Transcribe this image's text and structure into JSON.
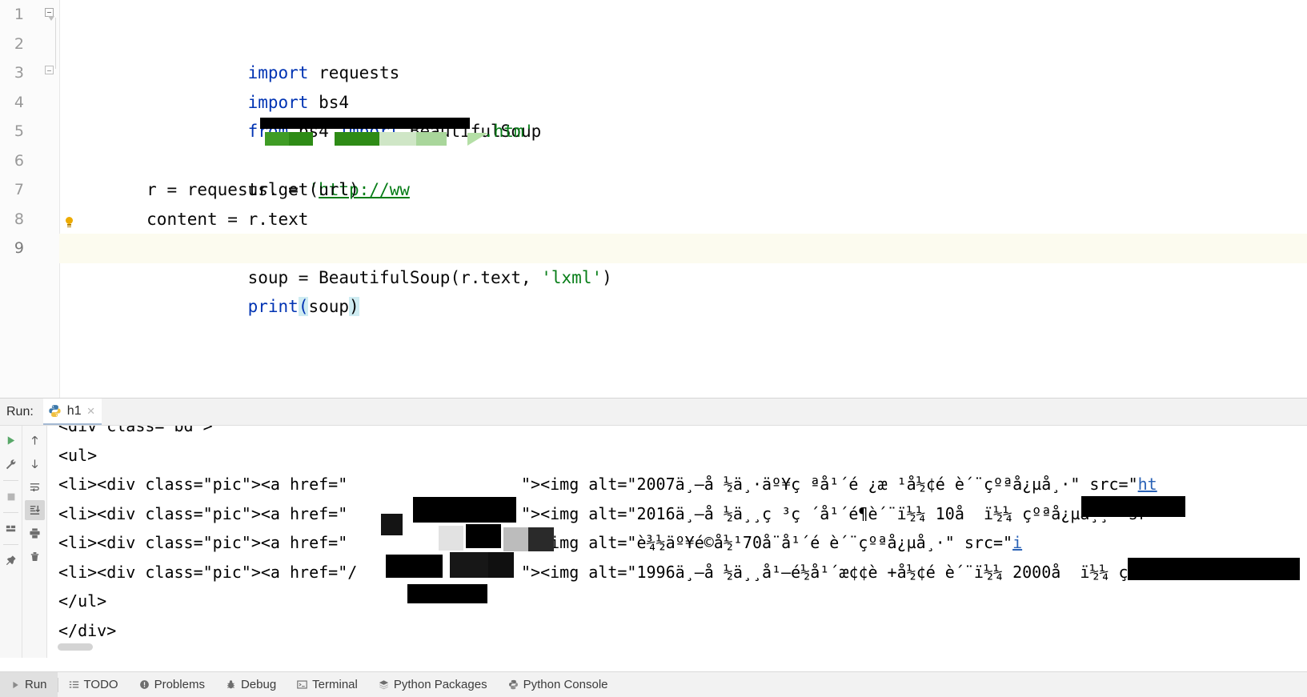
{
  "editor": {
    "lines": [
      {
        "num": "1",
        "tokens": [
          {
            "t": "import",
            "c": "kw"
          },
          {
            "t": " requests",
            "c": "plain"
          }
        ]
      },
      {
        "num": "2",
        "tokens": [
          {
            "t": "import",
            "c": "kw"
          },
          {
            "t": " bs4",
            "c": "plain"
          }
        ]
      },
      {
        "num": "3",
        "tokens": [
          {
            "t": "from",
            "c": "kw"
          },
          {
            "t": " bs4 ",
            "c": "plain"
          },
          {
            "t": "import",
            "c": "kw"
          },
          {
            "t": " BeautifulSoup",
            "c": "plain"
          }
        ]
      },
      {
        "num": "4",
        "tokens": []
      },
      {
        "num": "5",
        "tokens": [
          {
            "t": "url = ",
            "c": "plain"
          },
          {
            "t": "'",
            "c": "str"
          },
          {
            "t": "http://ww",
            "c": "link"
          }
        ]
      },
      {
        "num": "6",
        "tokens": [
          {
            "t": "r = requests.get(url)",
            "c": "plain"
          }
        ]
      },
      {
        "num": "7",
        "tokens": [
          {
            "t": "content = r.text",
            "c": "plain"
          }
        ]
      },
      {
        "num": "8",
        "tokens": [
          {
            "t": "soup = BeautifulSoup(r.text, ",
            "c": "plain"
          },
          {
            "t": "'lxml'",
            "c": "str"
          },
          {
            "t": ")",
            "c": "plain"
          }
        ]
      },
      {
        "num": "9",
        "tokens": []
      }
    ],
    "line5_suffix": ".htm'",
    "line9": {
      "kw": "print",
      "open": "(",
      "arg": "soup",
      "close": ")"
    },
    "current_line": "9"
  },
  "run_panel": {
    "label": "Run:",
    "tab_name": "h1",
    "tab_close": "×",
    "toolbar_left": [
      {
        "name": "rerun-button",
        "icon": "play-icon"
      },
      {
        "name": "settings-button",
        "icon": "wrench-icon"
      },
      {
        "name": "stop-button",
        "icon": "stop-icon"
      },
      {
        "name": "layout-button",
        "icon": "layout-icon"
      },
      {
        "name": "pin-button",
        "icon": "pin-icon"
      }
    ],
    "toolbar_right": [
      {
        "name": "up-button",
        "icon": "arrow-up-icon"
      },
      {
        "name": "down-button",
        "icon": "arrow-down-icon"
      },
      {
        "name": "soft-wrap-button",
        "icon": "soft-wrap-icon"
      },
      {
        "name": "scroll-to-end-button",
        "icon": "scroll-end-icon"
      },
      {
        "name": "print-button",
        "icon": "printer-icon"
      },
      {
        "name": "clear-all-button",
        "icon": "trash-icon"
      }
    ],
    "console_lines": [
      {
        "text": "<div class=\"bd\">",
        "clipped": true
      },
      {
        "text": "<ul>"
      },
      {
        "text": "<li><div class=\"pic\"><a href=\"",
        "redacted": true,
        "tail": "\"><img alt=\"2007ä¸–å ½ä¸·äº¥ç ªå¹´é ¿æ ¹å½¢é è´¨çºªå¿µå¸·\" src=\"",
        "link_tail": "ht"
      },
      {
        "text": "<li><div class=\"pic\"><a href=\"",
        "redacted": true,
        "tail": "\"><img alt=\"2016ä¸–å ½ä¸¸ç ³ç ´å¹´é¶è´¨ï½¼ 10å  ï½¼ çºªå¿µå¸¸\" sr"
      },
      {
        "text": "<li><div class=\"pic\"><a href=\"",
        "redacted": true,
        "tail": "\"><img alt=\"è¾½äº¥é©å½¹70å¨å¹´é è´¨çºªå¿µå¸·\" src=\"",
        "link_tail": "i"
      },
      {
        "text": "<li><div class=\"pic\"><a href=\"/",
        "redacted": true,
        "tail": "\"><img alt=\"1996ä¸–å ½ä¸¸å¹–é½å¹´æ¢¢è +å½¢é è´¨ï½¼ 2000å  ï½¼ ç"
      },
      {
        "text": "</ul>"
      },
      {
        "text": "</div>"
      }
    ]
  },
  "statusbar": {
    "items": [
      {
        "label": "Run",
        "icon": "play-icon",
        "active": true
      },
      {
        "label": "TODO",
        "icon": "todo-list-icon",
        "active": false
      },
      {
        "label": "Problems",
        "icon": "warning-circle-icon",
        "active": false
      },
      {
        "label": "Debug",
        "icon": "bug-icon",
        "active": false
      },
      {
        "label": "Terminal",
        "icon": "terminal-icon",
        "active": false
      },
      {
        "label": "Python Packages",
        "icon": "layers-icon",
        "active": false
      },
      {
        "label": "Python Console",
        "icon": "python-icon",
        "active": false
      }
    ]
  },
  "colors": {
    "keyword": "#0033b3",
    "string": "#067d17",
    "link": "#2a62b6",
    "current_line_bg": "#fcfbef",
    "accent_green": "#2e8b16",
    "tab_underline": "#a4b9d3"
  }
}
